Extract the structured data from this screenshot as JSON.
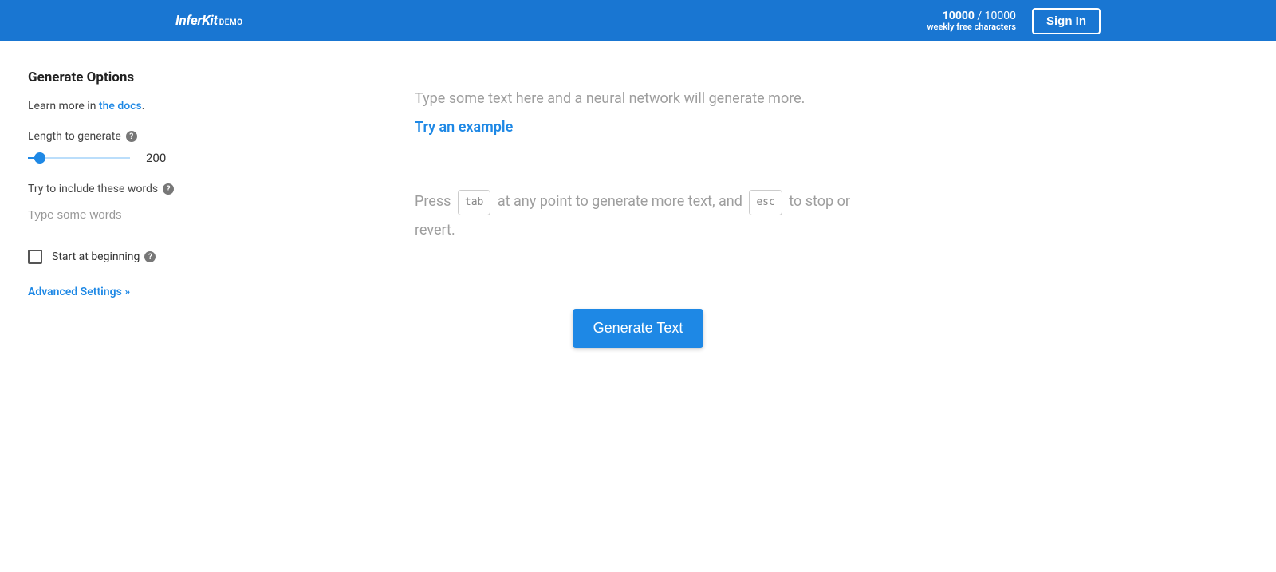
{
  "header": {
    "logo_main": "InferKit",
    "logo_sub": "DEMO",
    "chars_current": "10000",
    "chars_sep": " / ",
    "chars_total": "10000",
    "chars_sub": "weekly free characters",
    "signin": "Sign In"
  },
  "sidebar": {
    "title": "Generate Options",
    "learn_prefix": "Learn more in ",
    "learn_link": "the docs",
    "learn_suffix": ".",
    "length_label": "Length to generate",
    "length_value": "200",
    "include_label": "Try to include these words",
    "include_placeholder": "Type some words",
    "start_label": "Start at beginning",
    "advanced": "Advanced Settings »"
  },
  "editor": {
    "placeholder": "Type some text here and a neural network will generate more.",
    "try_example": "Try an example",
    "hint_press": "Press ",
    "hint_tab": "tab",
    "hint_mid": " at any point to generate more text, and ",
    "hint_esc": "esc",
    "hint_end": " to stop or revert."
  },
  "actions": {
    "generate": "Generate Text"
  }
}
